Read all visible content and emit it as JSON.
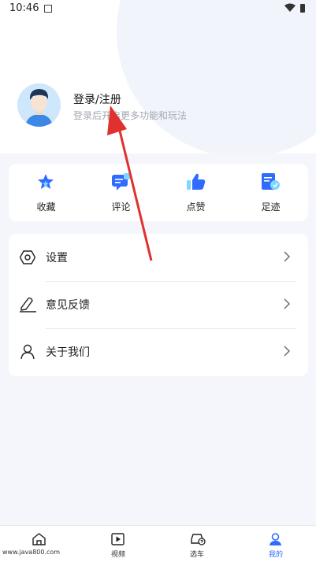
{
  "status_bar": {
    "time": "10:46"
  },
  "profile": {
    "title": "登录/注册",
    "subtitle": "登录后开启更多功能和玩法"
  },
  "quick_actions": [
    {
      "label": "收藏",
      "icon": "star-icon"
    },
    {
      "label": "评论",
      "icon": "comment-icon"
    },
    {
      "label": "点赞",
      "icon": "thumbs-up-icon"
    },
    {
      "label": "足迹",
      "icon": "footprint-document-icon"
    }
  ],
  "menu": [
    {
      "label": "设置",
      "icon": "settings-hexagon-icon"
    },
    {
      "label": "意见反馈",
      "icon": "feedback-pen-icon"
    },
    {
      "label": "关于我们",
      "icon": "person-icon"
    }
  ],
  "tabbar": [
    {
      "label": "",
      "icon": "home-icon"
    },
    {
      "label": "视频",
      "icon": "video-icon"
    },
    {
      "label": "选车",
      "icon": "car-select-icon"
    },
    {
      "label": "我的",
      "icon": "profile-icon",
      "active": true
    }
  ],
  "watermark": "www.java800.com",
  "colors": {
    "accent": "#2f6bff",
    "arrow": "#e0302f"
  }
}
